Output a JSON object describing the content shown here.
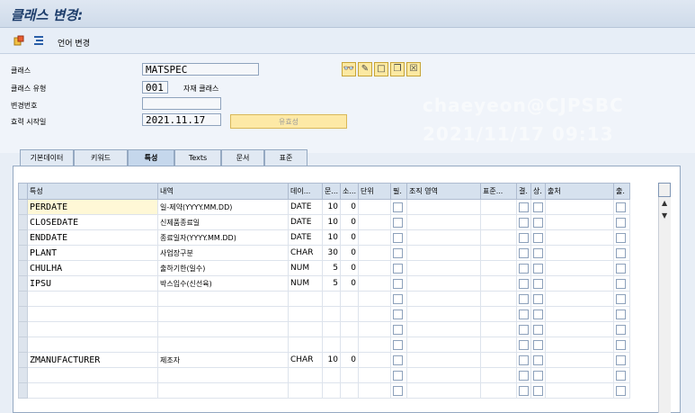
{
  "window": {
    "title": "클래스 변경:"
  },
  "toolbar": {
    "language_change": "언어 변경",
    "icons": [
      "create-object-icon",
      "hierarchy-icon"
    ]
  },
  "form": {
    "class_label": "클래스",
    "class_value": "MATSPEC",
    "class_type_label": "클래스 유형",
    "class_type_value": "001",
    "class_type_desc": "자재 클래스",
    "change_no_label": "변경번호",
    "change_no_value": "",
    "valid_from_label": "효력 시작일",
    "valid_from_value": "2021.11.17",
    "validity_button": "유효성",
    "action_icons": [
      "display-icon",
      "pencil-icon",
      "new-page-icon",
      "copy-icon",
      "delete-icon"
    ]
  },
  "watermark": {
    "user": "chaeyeon@CJPSBC",
    "date": "2021/11/17 09:13"
  },
  "tabs": [
    {
      "label": "기본데이터",
      "active": false
    },
    {
      "label": "키워드",
      "active": false
    },
    {
      "label": "특성",
      "active": true
    },
    {
      "label": "Texts",
      "active": false
    },
    {
      "label": "문서",
      "active": false
    },
    {
      "label": "표준",
      "active": false
    }
  ],
  "table": {
    "columns": [
      "특성",
      "내역",
      "데이...",
      "문...",
      "소...",
      "단위",
      "필.",
      "조직 영역",
      "표준...",
      "결.",
      "상.",
      "출처",
      "출."
    ],
    "rows": [
      {
        "char": "PERDATE",
        "desc": "일-제약(YYYY.MM.DD)",
        "type": "DATE",
        "len": "10",
        "dec": "0"
      },
      {
        "char": "CLOSEDATE",
        "desc": "신제품종료일",
        "type": "DATE",
        "len": "10",
        "dec": "0"
      },
      {
        "char": "ENDDATE",
        "desc": "종료일자(YYYY.MM.DD)",
        "type": "DATE",
        "len": "10",
        "dec": "0"
      },
      {
        "char": "PLANT",
        "desc": "사업장구분",
        "type": "CHAR",
        "len": "30",
        "dec": "0"
      },
      {
        "char": "CHULHA",
        "desc": "출하기한(일수)",
        "type": "NUM",
        "len": "5",
        "dec": "0"
      },
      {
        "char": "IPSU",
        "desc": "박스입수(신선육)",
        "type": "NUM",
        "len": "5",
        "dec": "0"
      },
      {
        "char": "",
        "desc": "",
        "type": "",
        "len": "",
        "dec": ""
      },
      {
        "char": "",
        "desc": "",
        "type": "",
        "len": "",
        "dec": ""
      },
      {
        "char": "",
        "desc": "",
        "type": "",
        "len": "",
        "dec": ""
      },
      {
        "char": "",
        "desc": "",
        "type": "",
        "len": "",
        "dec": ""
      },
      {
        "char": "ZMANUFACTURER",
        "desc": "제조자",
        "type": "CHAR",
        "len": "10",
        "dec": "0"
      },
      {
        "char": "",
        "desc": "",
        "type": "",
        "len": "",
        "dec": ""
      },
      {
        "char": "",
        "desc": "",
        "type": "",
        "len": "",
        "dec": ""
      }
    ]
  }
}
